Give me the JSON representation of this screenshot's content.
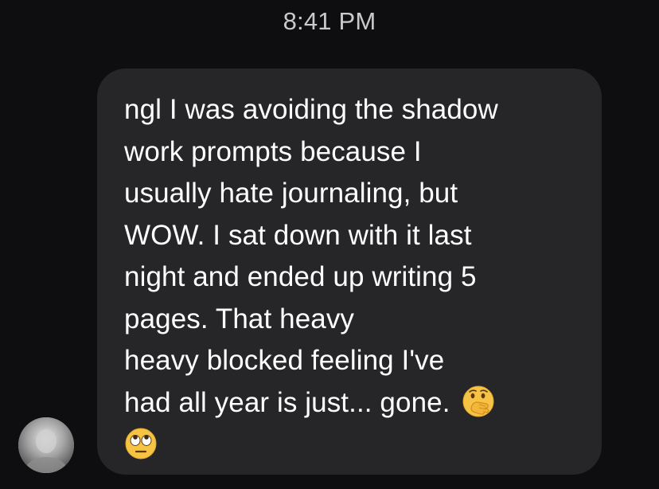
{
  "header": {
    "timestamp": "8:41 PM"
  },
  "message": {
    "lines": [
      "ngl I was avoiding the shadow",
      "work prompts because I",
      "usually hate journaling, but",
      "WOW. I sat down with it last",
      "night and ended up writing 5",
      "pages. That heavy",
      "heavy blocked feeling I've",
      "had all year is just... gone."
    ],
    "emojis": [
      "hand-over-mouth-emoji",
      "eye-roll-emoji"
    ]
  },
  "sender": {
    "avatar_icon": "avatar"
  },
  "colors": {
    "background": "#0e0e10",
    "bubble": "#262629",
    "text": "#ffffff",
    "timestamp": "#c9c9cc",
    "emoji_yellow": "#f6c344"
  }
}
